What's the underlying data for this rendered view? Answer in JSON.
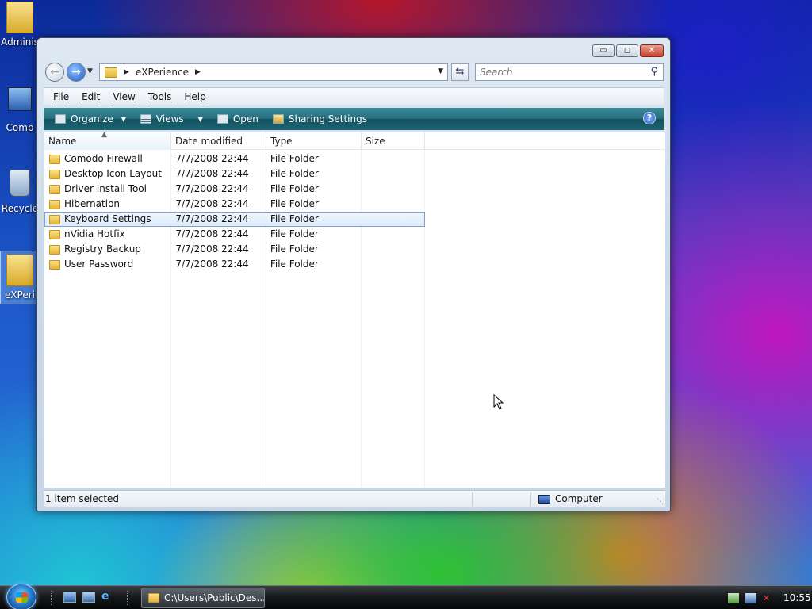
{
  "desktop": {
    "icons": [
      {
        "label": "Adminis"
      },
      {
        "label": "Comp"
      },
      {
        "label": "Recycle"
      },
      {
        "label": "eXPeri"
      }
    ]
  },
  "window": {
    "controls": {
      "minimize": "▭",
      "maximize": "◻",
      "close": "✕"
    },
    "address": {
      "crumb": "eXPerience"
    },
    "search": {
      "placeholder": "Search"
    },
    "menu": [
      "File",
      "Edit",
      "View",
      "Tools",
      "Help"
    ],
    "toolbar": {
      "organize": "Organize",
      "views": "Views",
      "open": "Open",
      "sharing": "Sharing Settings"
    },
    "columns": [
      "Name",
      "Date modified",
      "Type",
      "Size"
    ],
    "files": [
      {
        "name": "Comodo Firewall",
        "date": "7/7/2008 22:44",
        "type": "File Folder",
        "size": ""
      },
      {
        "name": "Desktop Icon Layout",
        "date": "7/7/2008 22:44",
        "type": "File Folder",
        "size": ""
      },
      {
        "name": "Driver Install Tool",
        "date": "7/7/2008 22:44",
        "type": "File Folder",
        "size": ""
      },
      {
        "name": "Hibernation",
        "date": "7/7/2008 22:44",
        "type": "File Folder",
        "size": ""
      },
      {
        "name": "Keyboard Settings",
        "date": "7/7/2008 22:44",
        "type": "File Folder",
        "size": ""
      },
      {
        "name": "nVidia Hotfix",
        "date": "7/7/2008 22:44",
        "type": "File Folder",
        "size": ""
      },
      {
        "name": "Registry Backup",
        "date": "7/7/2008 22:44",
        "type": "File Folder",
        "size": ""
      },
      {
        "name": "User Password",
        "date": "7/7/2008 22:44",
        "type": "File Folder",
        "size": ""
      }
    ],
    "selected_index": 4,
    "status": {
      "left": "1 item selected",
      "zone": "Computer"
    }
  },
  "taskbar": {
    "task_label": "C:\\Users\\Public\\Des...",
    "clock": "10:55"
  },
  "colors": {
    "command_bar": "#226d7c",
    "selection": "#dcebfb",
    "accent": "#2a7fd1"
  }
}
